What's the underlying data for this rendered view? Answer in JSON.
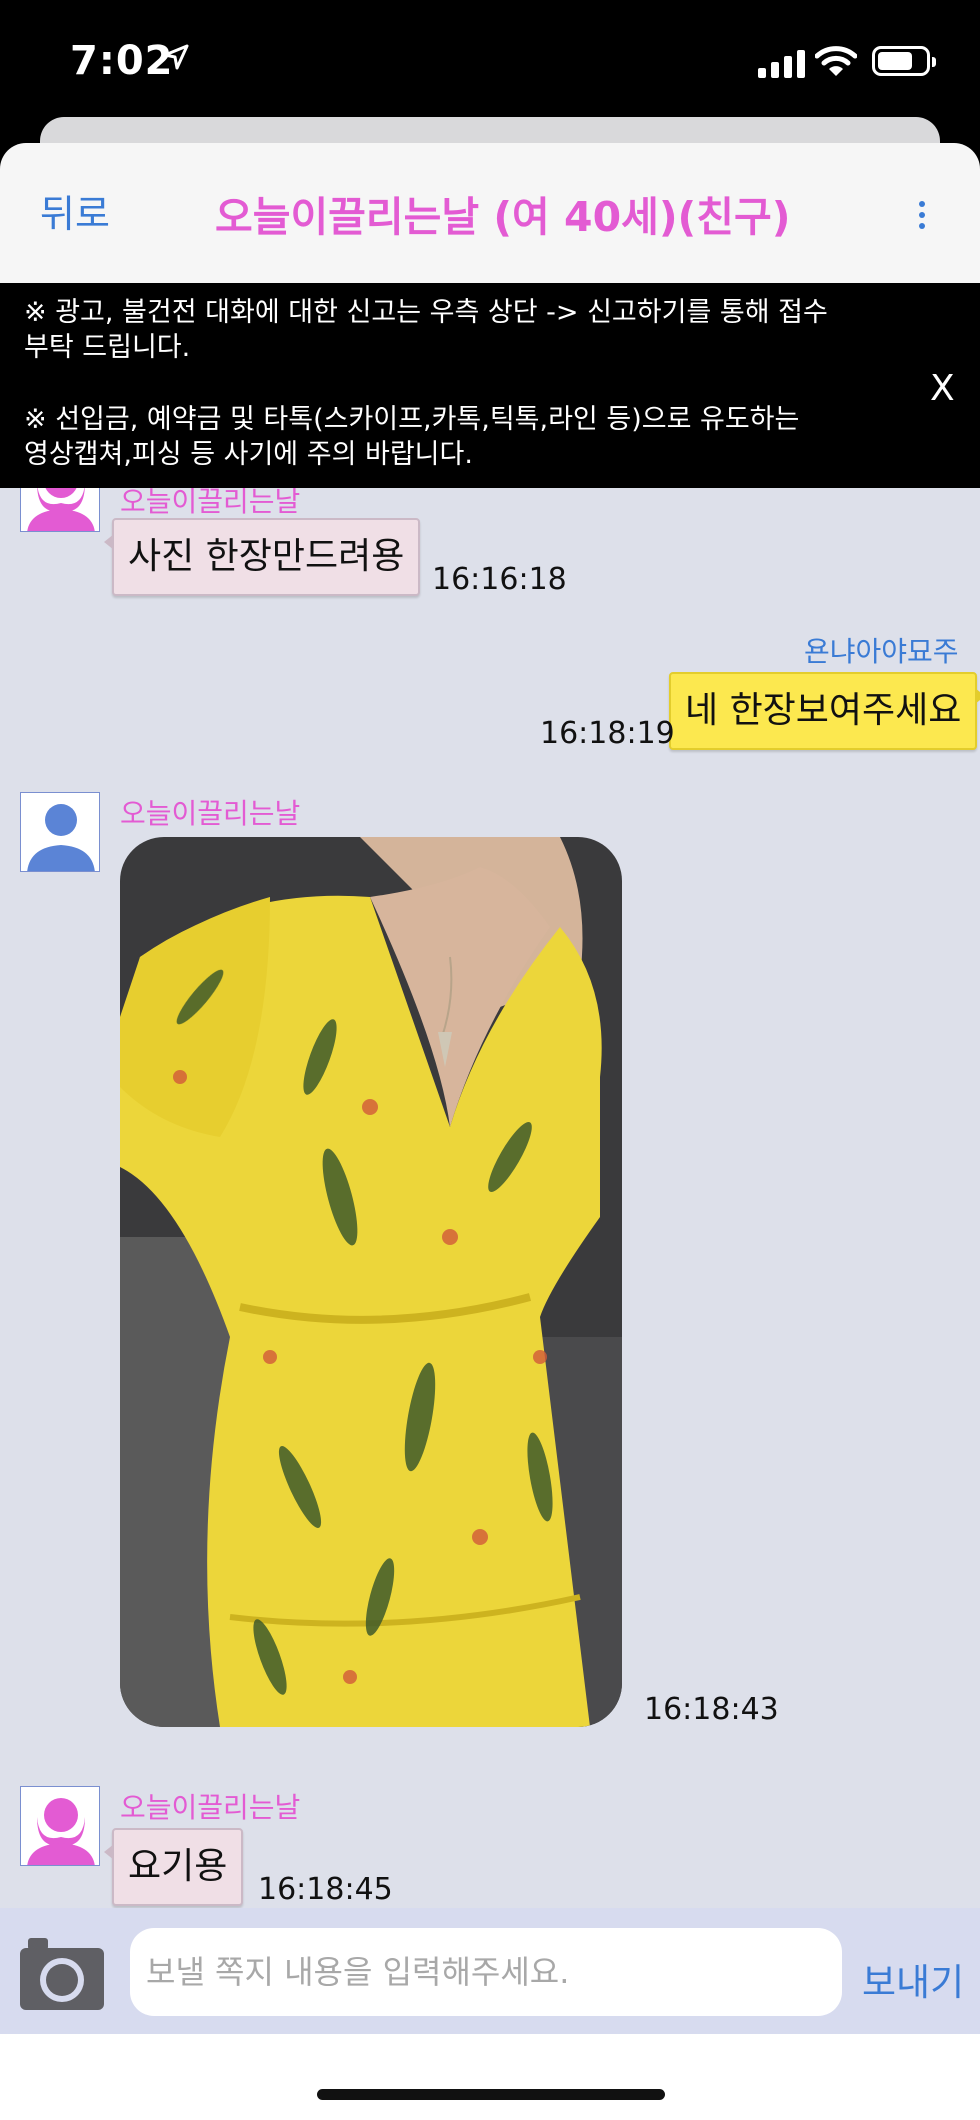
{
  "status_bar": {
    "time": "7:02"
  },
  "header": {
    "back_label": "뒤로",
    "title": "오늘이끌리는날 (여 40세)(친구)"
  },
  "notice": {
    "lines": [
      "※ 광고, 불건전 대화에 대한 신고는 우측 상단 -> 신고하기를 통해 접수",
      "부탁 드립니다.",
      "※ 선입금, 예약금 및 타톡(스카이프,카톡,틱톡,라인 등)으로 유도하는",
      "영상캡쳐,피싱 등 사기에 주의 바랍니다."
    ],
    "close_label": "X"
  },
  "messages": [
    {
      "side": "her",
      "sender": "오늘이끌리는날",
      "text": "사진 한장만드려용",
      "time": "16:16:18"
    },
    {
      "side": "me",
      "sender": "욘냐아야묘주",
      "text": "네 한장보여주세요",
      "time": "16:18:19"
    },
    {
      "side": "her",
      "sender": "오늘이끌리는날",
      "type": "photo",
      "time": "16:18:43"
    },
    {
      "side": "her",
      "sender": "오늘이끌리는날",
      "text": "요기용",
      "time": "16:18:45"
    }
  ],
  "input": {
    "placeholder": "보낼 쪽지 내용을 입력해주세요.",
    "send_label": "보내기"
  },
  "colors": {
    "her_name": "#e35bd3",
    "my_name": "#3a7bd5",
    "her_bubble": "#f0dfe6",
    "my_bubble": "#fce84f",
    "chat_background": "#dde0ea"
  }
}
